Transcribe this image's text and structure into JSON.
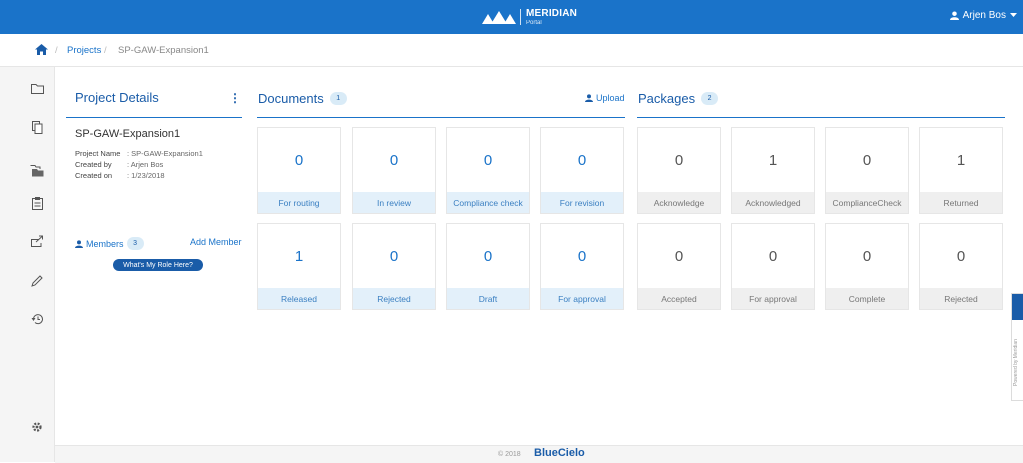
{
  "header": {
    "brand_name": "MERIDIAN",
    "brand_sub": "Portal",
    "user_name": "Arjen Bos",
    "accent_color": "#1a73c9"
  },
  "breadcrumb": {
    "separator": "/",
    "projects_label": "Projects",
    "current": "SP-GAW-Expansion1"
  },
  "sidebar": {
    "icons": [
      "folder-icon",
      "copy-icon",
      "folder-stack-icon",
      "clipboard-icon",
      "export-icon",
      "pencil-icon",
      "history-icon",
      "gear-icon"
    ]
  },
  "project_details": {
    "title": "Project Details",
    "menu_icon": "⋮",
    "project_title": "SP-GAW-Expansion1",
    "meta": [
      {
        "key": "Project Name",
        "value": ": SP-GAW-Expansion1"
      },
      {
        "key": "Created by",
        "value": ": Arjen Bos"
      },
      {
        "key": "Created on",
        "value": ": 1/23/2018"
      }
    ],
    "members_label": "Members",
    "members_count": "3",
    "add_member_label": "Add Member",
    "role_button_label": "What's My Role Here?"
  },
  "documents": {
    "title": "Documents",
    "count": "1",
    "upload_label": "Upload",
    "tiles": [
      {
        "value": "0",
        "label": "For routing"
      },
      {
        "value": "0",
        "label": "In review"
      },
      {
        "value": "0",
        "label": "Compliance check"
      },
      {
        "value": "0",
        "label": "For revision"
      },
      {
        "value": "1",
        "label": "Released"
      },
      {
        "value": "0",
        "label": "Rejected"
      },
      {
        "value": "0",
        "label": "Draft"
      },
      {
        "value": "0",
        "label": "For approval"
      }
    ]
  },
  "packages": {
    "title": "Packages",
    "count": "2",
    "tiles": [
      {
        "value": "0",
        "label": "Acknowledge"
      },
      {
        "value": "1",
        "label": "Acknowledged"
      },
      {
        "value": "0",
        "label": "ComplianceCheck"
      },
      {
        "value": "1",
        "label": "Returned"
      },
      {
        "value": "0",
        "label": "Accepted"
      },
      {
        "value": "0",
        "label": "For approval"
      },
      {
        "value": "0",
        "label": "Complete"
      },
      {
        "value": "0",
        "label": "Rejected"
      }
    ]
  },
  "side_widget": {
    "text": "Powered by Meridian"
  },
  "footer": {
    "copyright": "© 2018",
    "brand": "BlueCielo"
  }
}
